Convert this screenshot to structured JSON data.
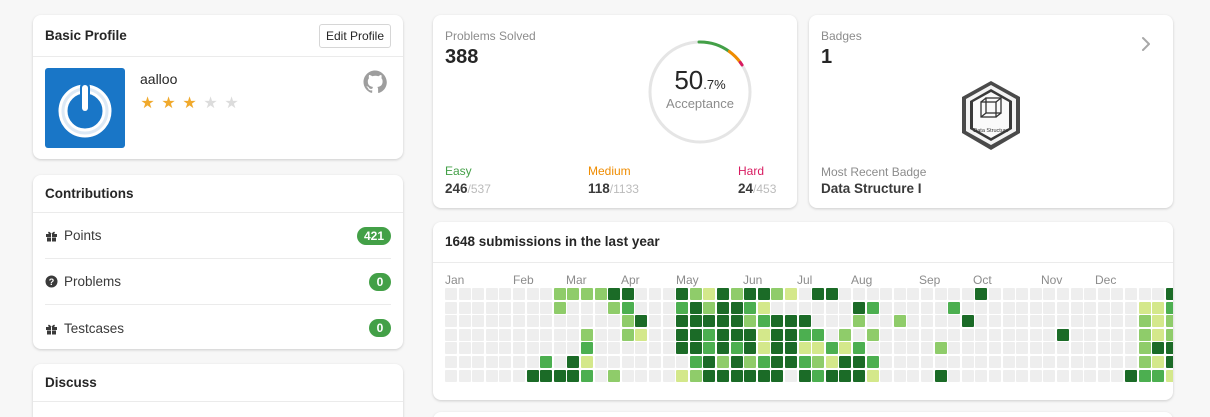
{
  "profile": {
    "title": "Basic Profile",
    "edit_label": "Edit Profile",
    "username": "aalloo",
    "rating": 3,
    "max_rating": 5,
    "star_char": "★"
  },
  "contributions": {
    "title": "Contributions",
    "items": [
      {
        "label": "Points",
        "value": "421",
        "icon": "gift-icon"
      },
      {
        "label": "Problems",
        "value": "0",
        "icon": "question-circle-icon"
      },
      {
        "label": "Testcases",
        "value": "0",
        "icon": "gift-icon"
      }
    ]
  },
  "discuss": {
    "title": "Discuss"
  },
  "solved": {
    "label": "Problems Solved",
    "count": "388",
    "acceptance_int": "50",
    "acceptance_dec": ".7%",
    "acceptance_label": "Acceptance",
    "acceptance_fraction": 0.507,
    "easy": {
      "label": "Easy",
      "solved": "246",
      "total": "/537",
      "color": "#43a047"
    },
    "medium": {
      "label": "Medium",
      "solved": "118",
      "total": "/1133",
      "color": "#ef8c00"
    },
    "hard": {
      "label": "Hard",
      "solved": "24",
      "total": "/453",
      "color": "#d81b60"
    }
  },
  "badges": {
    "label": "Badges",
    "count": "1",
    "badge_image_text": "Data Structure",
    "recent_label": "Most Recent Badge",
    "recent_name": "Data Structure I"
  },
  "submissions": {
    "title": "1648 submissions in the last year",
    "months": [
      "Jan",
      "Feb",
      "Mar",
      "Apr",
      "May",
      "Jun",
      "Jul",
      "Aug",
      "Sep",
      "Oct",
      "Nov",
      "Dec"
    ],
    "colors": [
      "#eeeeee",
      "#d4e88b",
      "#8fcc6a",
      "#4caf50",
      "#1b6b27"
    ],
    "weeks": [
      [
        0,
        0,
        0,
        0,
        0,
        0,
        0
      ],
      [
        0,
        0,
        0,
        0,
        0,
        0,
        0
      ],
      [
        0,
        0,
        0,
        0,
        0,
        0,
        0
      ],
      [
        0,
        0,
        0,
        0,
        0,
        0,
        0
      ],
      [
        0,
        0,
        0,
        0,
        0,
        0,
        0
      ],
      [
        0,
        0,
        0,
        0,
        0,
        0,
        0
      ],
      [
        0,
        0,
        0,
        0,
        0,
        0,
        4
      ],
      [
        0,
        0,
        0,
        0,
        0,
        3,
        4
      ],
      [
        2,
        2,
        0,
        0,
        0,
        0,
        4
      ],
      [
        2,
        0,
        0,
        0,
        0,
        4,
        4
      ],
      [
        2,
        0,
        0,
        2,
        3,
        1,
        3
      ],
      [
        2,
        0,
        0,
        0,
        0,
        0,
        0
      ],
      [
        4,
        2,
        0,
        0,
        0,
        0,
        2
      ],
      [
        4,
        3,
        2,
        2,
        0,
        0,
        0
      ],
      [
        0,
        0,
        4,
        1,
        0,
        0,
        0
      ],
      [
        0,
        0,
        0,
        0,
        0,
        0,
        0
      ],
      [
        0,
        0,
        0,
        0,
        0,
        0,
        0
      ],
      [
        4,
        3,
        4,
        4,
        4,
        0,
        1
      ],
      [
        2,
        4,
        4,
        4,
        4,
        3,
        2
      ],
      [
        1,
        2,
        4,
        3,
        3,
        4,
        4
      ],
      [
        4,
        4,
        4,
        4,
        4,
        2,
        4
      ],
      [
        2,
        4,
        4,
        4,
        3,
        4,
        4
      ],
      [
        4,
        3,
        2,
        4,
        4,
        2,
        4
      ],
      [
        4,
        1,
        3,
        1,
        1,
        3,
        4
      ],
      [
        2,
        0,
        4,
        4,
        4,
        4,
        4
      ],
      [
        1,
        0,
        4,
        4,
        4,
        4,
        0
      ],
      [
        0,
        0,
        4,
        3,
        1,
        3,
        4
      ],
      [
        4,
        0,
        0,
        3,
        1,
        2,
        3
      ],
      [
        4,
        0,
        0,
        0,
        3,
        1,
        4
      ],
      [
        0,
        0,
        0,
        2,
        1,
        4,
        4
      ],
      [
        0,
        4,
        2,
        0,
        3,
        4,
        4
      ],
      [
        0,
        3,
        0,
        2,
        0,
        3,
        1
      ],
      [
        0,
        0,
        0,
        0,
        0,
        0,
        0
      ],
      [
        0,
        0,
        2,
        0,
        0,
        0,
        0
      ],
      [
        0,
        0,
        0,
        0,
        0,
        0,
        0
      ],
      [
        0,
        0,
        0,
        0,
        0,
        0,
        0
      ],
      [
        0,
        0,
        0,
        0,
        2,
        0,
        4
      ],
      [
        0,
        3,
        0,
        0,
        0,
        0,
        0
      ],
      [
        0,
        0,
        4,
        0,
        0,
        0,
        0
      ],
      [
        4,
        0,
        0,
        0,
        0,
        0,
        0
      ],
      [
        0,
        0,
        0,
        0,
        0,
        0,
        0
      ],
      [
        0,
        0,
        0,
        0,
        0,
        0,
        0
      ],
      [
        0,
        0,
        0,
        0,
        0,
        0,
        0
      ],
      [
        0,
        0,
        0,
        0,
        0,
        0,
        0
      ],
      [
        0,
        0,
        0,
        0,
        0,
        0,
        0
      ],
      [
        0,
        0,
        0,
        4,
        0,
        0,
        0
      ],
      [
        0,
        0,
        0,
        0,
        0,
        0,
        0
      ],
      [
        0,
        0,
        0,
        0,
        0,
        0,
        0
      ],
      [
        0,
        0,
        0,
        0,
        0,
        0,
        0
      ],
      [
        0,
        0,
        0,
        0,
        0,
        0,
        0
      ],
      [
        0,
        0,
        0,
        0,
        0,
        0,
        4
      ],
      [
        0,
        1,
        2,
        2,
        2,
        2,
        3
      ],
      [
        0,
        1,
        1,
        1,
        4,
        1,
        3
      ],
      [
        4,
        3,
        2,
        2,
        4,
        4,
        1
      ]
    ]
  }
}
